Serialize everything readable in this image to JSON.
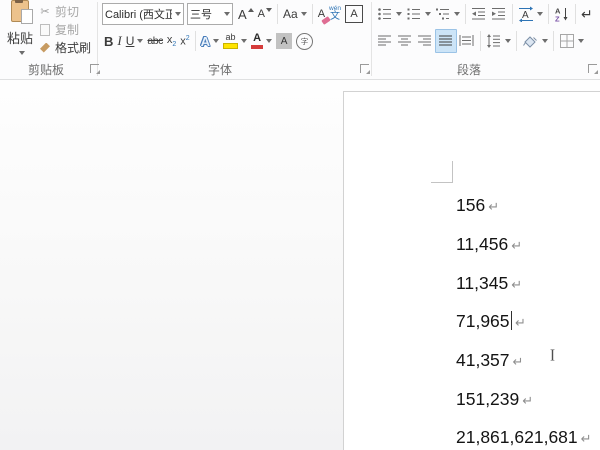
{
  "ribbon": {
    "clipboard": {
      "group_label": "剪贴板",
      "paste_label": "粘贴",
      "cut_label": "剪切",
      "copy_label": "复制",
      "format_painter_label": "格式刷"
    },
    "font": {
      "group_label": "字体",
      "font_name_value": "Calibri (西文正",
      "font_size_value": "三号",
      "grow_font": "A",
      "shrink_font": "A",
      "change_case": "Aa",
      "clear_formatting": "A",
      "phonetic_guide_top": "wén",
      "phonetic_guide_bottom": "文",
      "character_border": "A",
      "bold": "B",
      "italic": "I",
      "underline": "U",
      "strikethrough": "abc",
      "subscript_base": "x",
      "subscript_mark": "2",
      "superscript_base": "x",
      "superscript_mark": "2",
      "text_effects": "A",
      "highlight_ab": "ab",
      "font_color": "A",
      "character_shading": "A",
      "enclose_characters": "字"
    },
    "paragraph": {
      "group_label": "段落",
      "asian_layout": "A",
      "sort_a": "A",
      "sort_z": "Z",
      "show_marks_glyph": "↵"
    }
  },
  "icons": {
    "cut_glyph": "✂"
  },
  "document": {
    "values": [
      "156",
      "11,456",
      "11,345",
      "71,965",
      "41,357",
      "151,239",
      "21,861,621,681"
    ],
    "paragraph_mark": "↵",
    "ibeam_cursor_glyph": "I"
  },
  "colors": {
    "selected_button_bg": "#cce4f7",
    "selected_button_border": "#9bc3e6",
    "highlight_yellow": "#ffe400",
    "font_color_red": "#d53b3b",
    "clipboard_tan": "#ecc28c",
    "pinyin_blue": "#2e74b5",
    "page_bg": "#ffffff"
  }
}
